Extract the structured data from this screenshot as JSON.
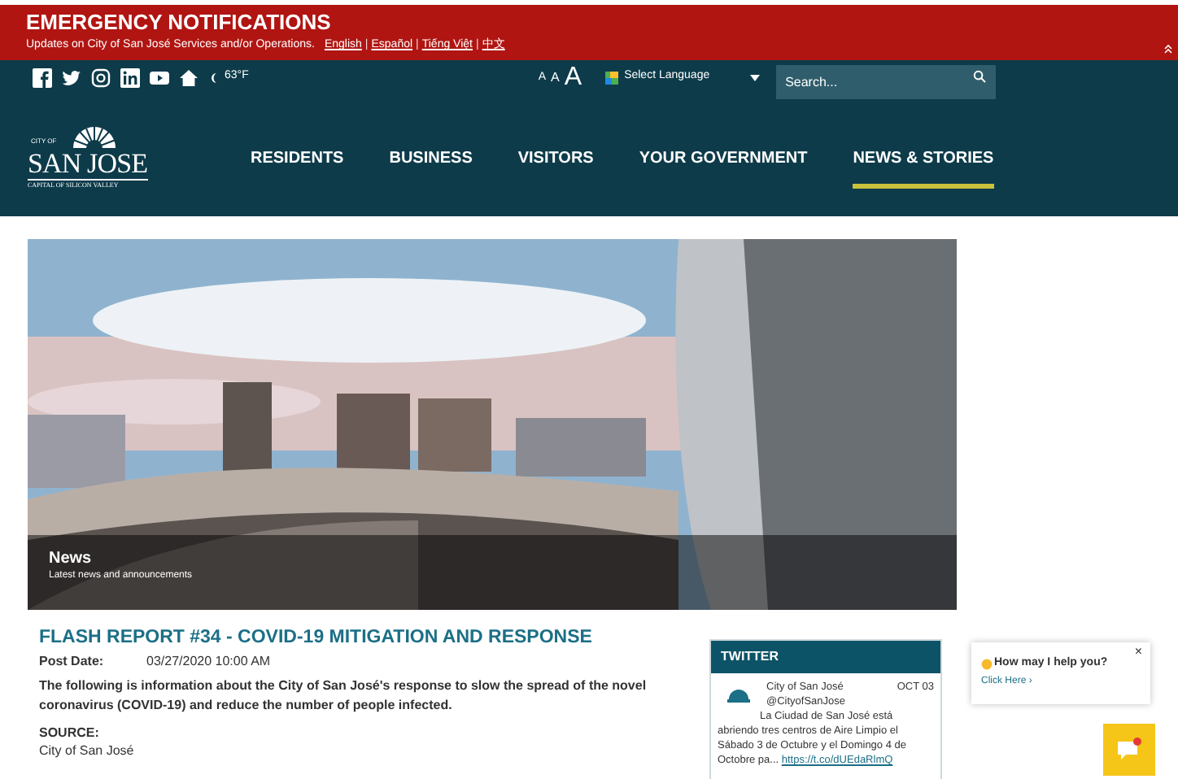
{
  "emergency": {
    "title": "EMERGENCY NOTIFICATIONS",
    "text": "Updates on City of San José Services and/or Operations.",
    "languages": [
      "English",
      "Español",
      "Tiếng Việt",
      "中文"
    ],
    "separator": "|"
  },
  "utility_bar": {
    "weather": "63°F",
    "text_size": [
      "A",
      "A",
      "A"
    ],
    "language_select": "Select Language",
    "search": {
      "placeholder": "Search..."
    }
  },
  "logo": {
    "top": "CITY OF",
    "name": "SAN JOSE",
    "tagline": "CAPITAL OF SILICON VALLEY"
  },
  "nav": [
    {
      "label": "RESIDENTS",
      "selected": false
    },
    {
      "label": "BUSINESS",
      "selected": false
    },
    {
      "label": "VISITORS",
      "selected": false
    },
    {
      "label": "YOUR GOVERNMENT",
      "selected": false
    },
    {
      "label": "NEWS & STORIES",
      "selected": true
    }
  ],
  "hero": {
    "kind": "picture",
    "title": "News",
    "subtitle": "Latest news and announcements"
  },
  "article": {
    "title": "FLASH REPORT #34 - COVID-19 MITIGATION AND RESPONSE",
    "post_date_label": "Post Date:",
    "post_date": "03/27/2020 10:00 AM",
    "summary": "The following is information about the City of San José's response to slow the spread of the novel coronavirus (COVID-19) and reduce the number of people infected.",
    "source_label": "SOURCE:",
    "source": "City of San José"
  },
  "twitter": {
    "title": "TWITTER",
    "tweet": {
      "name": "City of San José",
      "handle": "@CityofSanJose",
      "date": "OCT 03",
      "text": "La Ciudad de San José está abriendo tres centros de Aire Limpio el Sábado 3 de Octubre y el Domingo 4 de Octobre pa...",
      "link": "https://t.co/dUEdaRlmQ"
    }
  },
  "chat": {
    "prompt": "How may I help you?",
    "link": "Click Here ›",
    "close": "×"
  }
}
